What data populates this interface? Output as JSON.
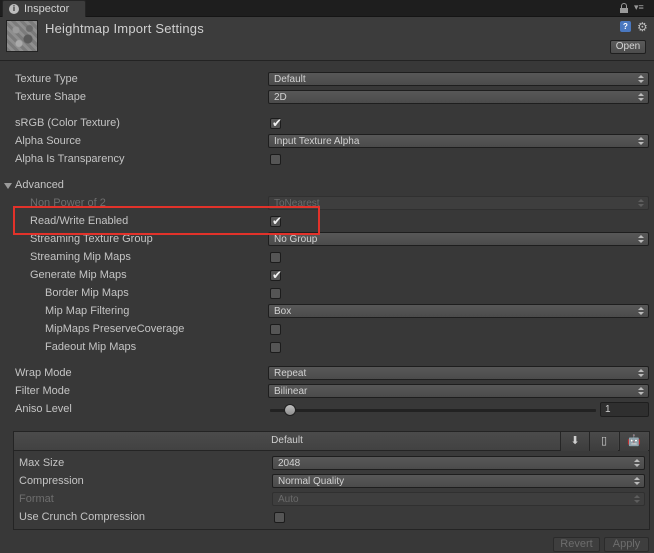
{
  "tab": {
    "label": "Inspector"
  },
  "header": {
    "title": "Heightmap Import Settings",
    "open_label": "Open",
    "help_glyph": "?",
    "gear_glyph": "⚙"
  },
  "settings": {
    "texture_type": {
      "label": "Texture Type",
      "value": "Default"
    },
    "texture_shape": {
      "label": "Texture Shape",
      "value": "2D"
    },
    "srgb": {
      "label": "sRGB (Color Texture)",
      "checked": true
    },
    "alpha_source": {
      "label": "Alpha Source",
      "value": "Input Texture Alpha"
    },
    "alpha_is_transparency": {
      "label": "Alpha Is Transparency",
      "checked": false
    },
    "advanced": {
      "label": "Advanced"
    },
    "non_power_of_2": {
      "label": "Non Power of 2",
      "value": "ToNearest",
      "disabled": true
    },
    "read_write": {
      "label": "Read/Write Enabled",
      "checked": true
    },
    "streaming_texture_group": {
      "label": "Streaming Texture Group",
      "value": "No Group"
    },
    "streaming_mip_maps": {
      "label": "Streaming Mip Maps",
      "checked": false
    },
    "generate_mip_maps": {
      "label": "Generate Mip Maps",
      "checked": true
    },
    "border_mip_maps": {
      "label": "Border Mip Maps",
      "checked": false
    },
    "mip_map_filtering": {
      "label": "Mip Map Filtering",
      "value": "Box"
    },
    "mipmaps_preserve_coverage": {
      "label": "MipMaps PreserveCoverage",
      "checked": false
    },
    "fadeout_mip_maps": {
      "label": "Fadeout Mip Maps",
      "checked": false
    },
    "wrap_mode": {
      "label": "Wrap Mode",
      "value": "Repeat"
    },
    "filter_mode": {
      "label": "Filter Mode",
      "value": "Bilinear"
    },
    "aniso_level": {
      "label": "Aniso Level",
      "value": "1",
      "slider_fraction": 0.06
    }
  },
  "platform": {
    "tab_default": "Default",
    "download_glyph": "⬇",
    "phone_glyph": "▯",
    "android_glyph": "🤖",
    "max_size": {
      "label": "Max Size",
      "value": "2048"
    },
    "compression": {
      "label": "Compression",
      "value": "Normal Quality"
    },
    "format": {
      "label": "Format",
      "value": "Auto",
      "disabled": true
    },
    "crunch": {
      "label": "Use Crunch Compression",
      "checked": false
    }
  },
  "buttons": {
    "revert": "Revert",
    "apply": "Apply"
  },
  "colors": {
    "highlight": "#e2322a",
    "background": "#383838"
  },
  "checkmark_glyph": "✔"
}
